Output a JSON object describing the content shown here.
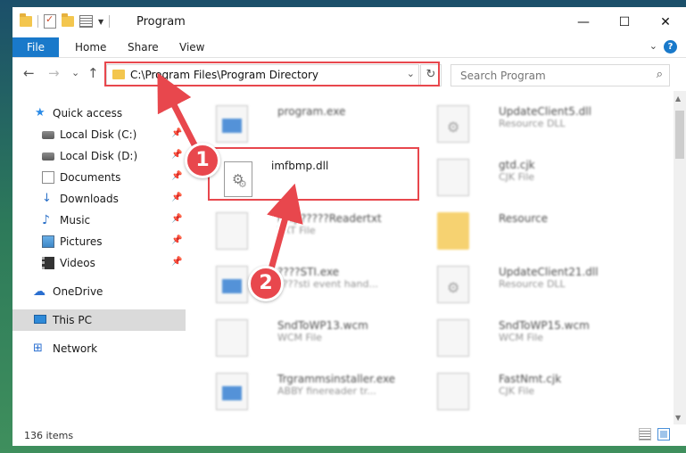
{
  "window": {
    "title": "Program",
    "controls": {
      "minimize": "—",
      "maximize": "☐",
      "close": "✕"
    }
  },
  "ribbon": {
    "tabs": [
      "File",
      "Home",
      "Share",
      "View"
    ],
    "help_icon": "?",
    "expand_icon": "⌄"
  },
  "nav": {
    "back": "←",
    "forward": "→",
    "recent": "⌄",
    "up": "↑",
    "address": "C:\\Program Files\\Program Directory",
    "address_dropdown": "⌄",
    "refresh": "↻",
    "search_placeholder": "Search Program",
    "search_icon": "⌕"
  },
  "sidebar": {
    "items": [
      {
        "label": "Quick access",
        "icon": "star-icon",
        "glyph": "★",
        "pinned": false
      },
      {
        "label": "Local Disk (C:)",
        "icon": "drive-icon",
        "pinned": true
      },
      {
        "label": "Local Disk (D:)",
        "icon": "drive-icon",
        "pinned": true
      },
      {
        "label": "Documents",
        "icon": "documents-icon",
        "pinned": true
      },
      {
        "label": "Downloads",
        "icon": "download-arrow-icon",
        "glyph": "↓",
        "pinned": true
      },
      {
        "label": "Music",
        "icon": "music-note-icon",
        "glyph": "♪",
        "pinned": true
      },
      {
        "label": "Pictures",
        "icon": "pictures-icon",
        "pinned": true
      },
      {
        "label": "Videos",
        "icon": "film-icon",
        "pinned": true
      },
      {
        "label": "OneDrive",
        "icon": "cloud-icon",
        "glyph": "☁",
        "pinned": false
      },
      {
        "label": "This PC",
        "icon": "computer-icon",
        "pinned": false,
        "selected": true
      },
      {
        "label": "Network",
        "icon": "network-icon",
        "glyph": "⊞",
        "pinned": false
      }
    ],
    "pin_glyph": "📌"
  },
  "files": {
    "left": [
      {
        "name": "program.exe",
        "type": "",
        "icon": "exe-icon"
      },
      {
        "name": "imfbmp.dll",
        "type": "",
        "icon": "dll-gear-icon",
        "highlighted": true
      },
      {
        "name": "help?????Readertxt",
        "type": "TXT File",
        "icon": "text-file-icon"
      },
      {
        "name": "????STI.exe",
        "type": "????sti event hand...",
        "icon": "exe-icon"
      },
      {
        "name": "SndToWP13.wcm",
        "type": "WCM File",
        "icon": "blank-file-icon"
      },
      {
        "name": "Trgrammsinstaller.exe",
        "type": "ABBY finereader tr...",
        "icon": "exe-icon"
      }
    ],
    "right": [
      {
        "name": "UpdateClient5.dll",
        "type": "Resource DLL",
        "icon": "dll-gear-icon"
      },
      {
        "name": "gtd.cjk",
        "type": "CJK File",
        "icon": "blank-file-icon"
      },
      {
        "name": "Resource",
        "type": "",
        "icon": "folder-icon"
      },
      {
        "name": "UpdateClient21.dll",
        "type": "Resource DLL",
        "icon": "dll-gear-icon"
      },
      {
        "name": "SndToWP15.wcm",
        "type": "WCM File",
        "icon": "blank-file-icon"
      },
      {
        "name": "FastNmt.cjk",
        "type": "CJK File",
        "icon": "blank-file-icon"
      }
    ]
  },
  "status": {
    "count": "136 items"
  },
  "annotations": {
    "badge1": "1",
    "badge2": "2"
  },
  "colors": {
    "accent": "#1979ca",
    "highlight": "#e8474d"
  }
}
